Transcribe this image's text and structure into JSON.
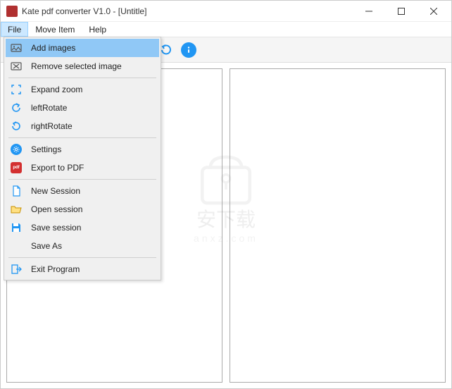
{
  "window": {
    "title": "Kate pdf converter V1.0 - [Untitle]"
  },
  "menubar": {
    "file": "File",
    "move": "Move Item",
    "help": "Help"
  },
  "dropdown": {
    "add_images": "Add images",
    "remove_selected": "Remove selected image",
    "expand_zoom": "Expand zoom",
    "left_rotate": "leftRotate",
    "right_rotate": "rightRotate",
    "settings": "Settings",
    "export_pdf": "Export to PDF",
    "new_session": "New Session",
    "open_session": "Open session",
    "save_session": "Save session",
    "save_as": "Save As",
    "exit": "Exit Program"
  },
  "watermark": {
    "main": "安下载",
    "sub": "anxz.com"
  },
  "icons": {
    "pdf_label": "pdf"
  }
}
